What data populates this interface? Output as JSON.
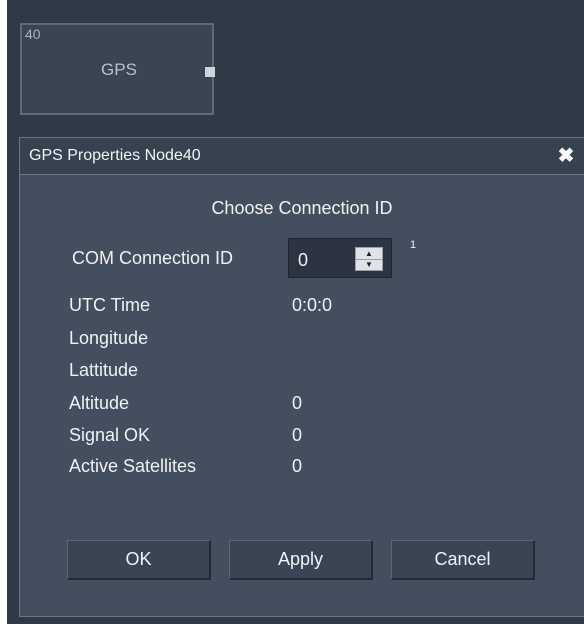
{
  "node": {
    "id": "40",
    "name": "GPS"
  },
  "dialog": {
    "title": "GPS Properties Node40",
    "close_glyph": "✖",
    "subtitle": "Choose Connection ID",
    "connection": {
      "label": "COM Connection ID",
      "value": "0",
      "superscript": "1",
      "up_glyph": "▲",
      "down_glyph": "▼"
    },
    "fields": [
      {
        "label": "UTC Time",
        "value": "0:0:0"
      },
      {
        "label": "Longitude",
        "value": ""
      },
      {
        "label": "Lattitude",
        "value": ""
      },
      {
        "label": "Altitude",
        "value": "0"
      },
      {
        "label": "Signal OK",
        "value": "0"
      },
      {
        "label": "Active Satellites",
        "value": "0"
      }
    ],
    "buttons": {
      "ok": "OK",
      "apply": "Apply",
      "cancel": "Cancel"
    }
  },
  "colors": {
    "canvas": "#2f3a47",
    "dialog": "#434e5e",
    "titlebar": "#374250"
  }
}
